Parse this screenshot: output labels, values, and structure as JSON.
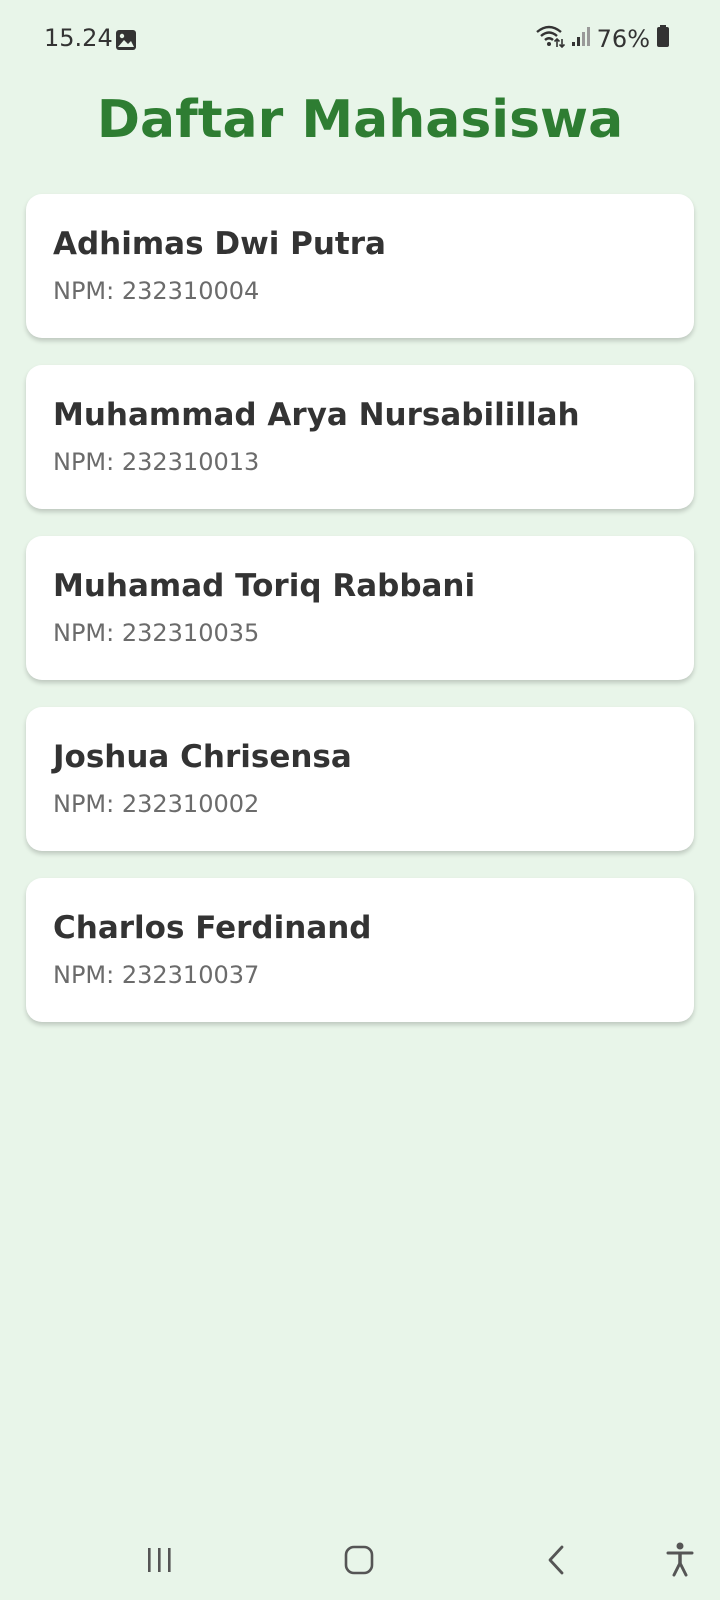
{
  "status_bar": {
    "time": "15.24",
    "battery": "76%",
    "icons": [
      "image-icon",
      "wifi-icon",
      "signal-icon",
      "battery-icon"
    ]
  },
  "header": {
    "title": "Daftar Mahasiswa"
  },
  "students": [
    {
      "name": "Adhimas Dwi Putra",
      "npm": "NPM: 232310004"
    },
    {
      "name": "Muhammad Arya Nursabilillah",
      "npm": "NPM: 232310013"
    },
    {
      "name": "Muhamad Toriq Rabbani",
      "npm": "NPM: 232310035"
    },
    {
      "name": "Joshua Chrisensa",
      "npm": "NPM: 232310002"
    },
    {
      "name": "Charlos Ferdinand",
      "npm": "NPM: 232310037"
    }
  ],
  "nav_bar": {
    "icons": [
      "recent-apps-icon",
      "home-icon",
      "back-icon",
      "accessibility-icon"
    ]
  },
  "colors": {
    "background": "#e8f5e9",
    "title": "#2e7d32",
    "card": "#ffffff",
    "name_text": "#333333",
    "npm_text": "#6b6b6b"
  }
}
